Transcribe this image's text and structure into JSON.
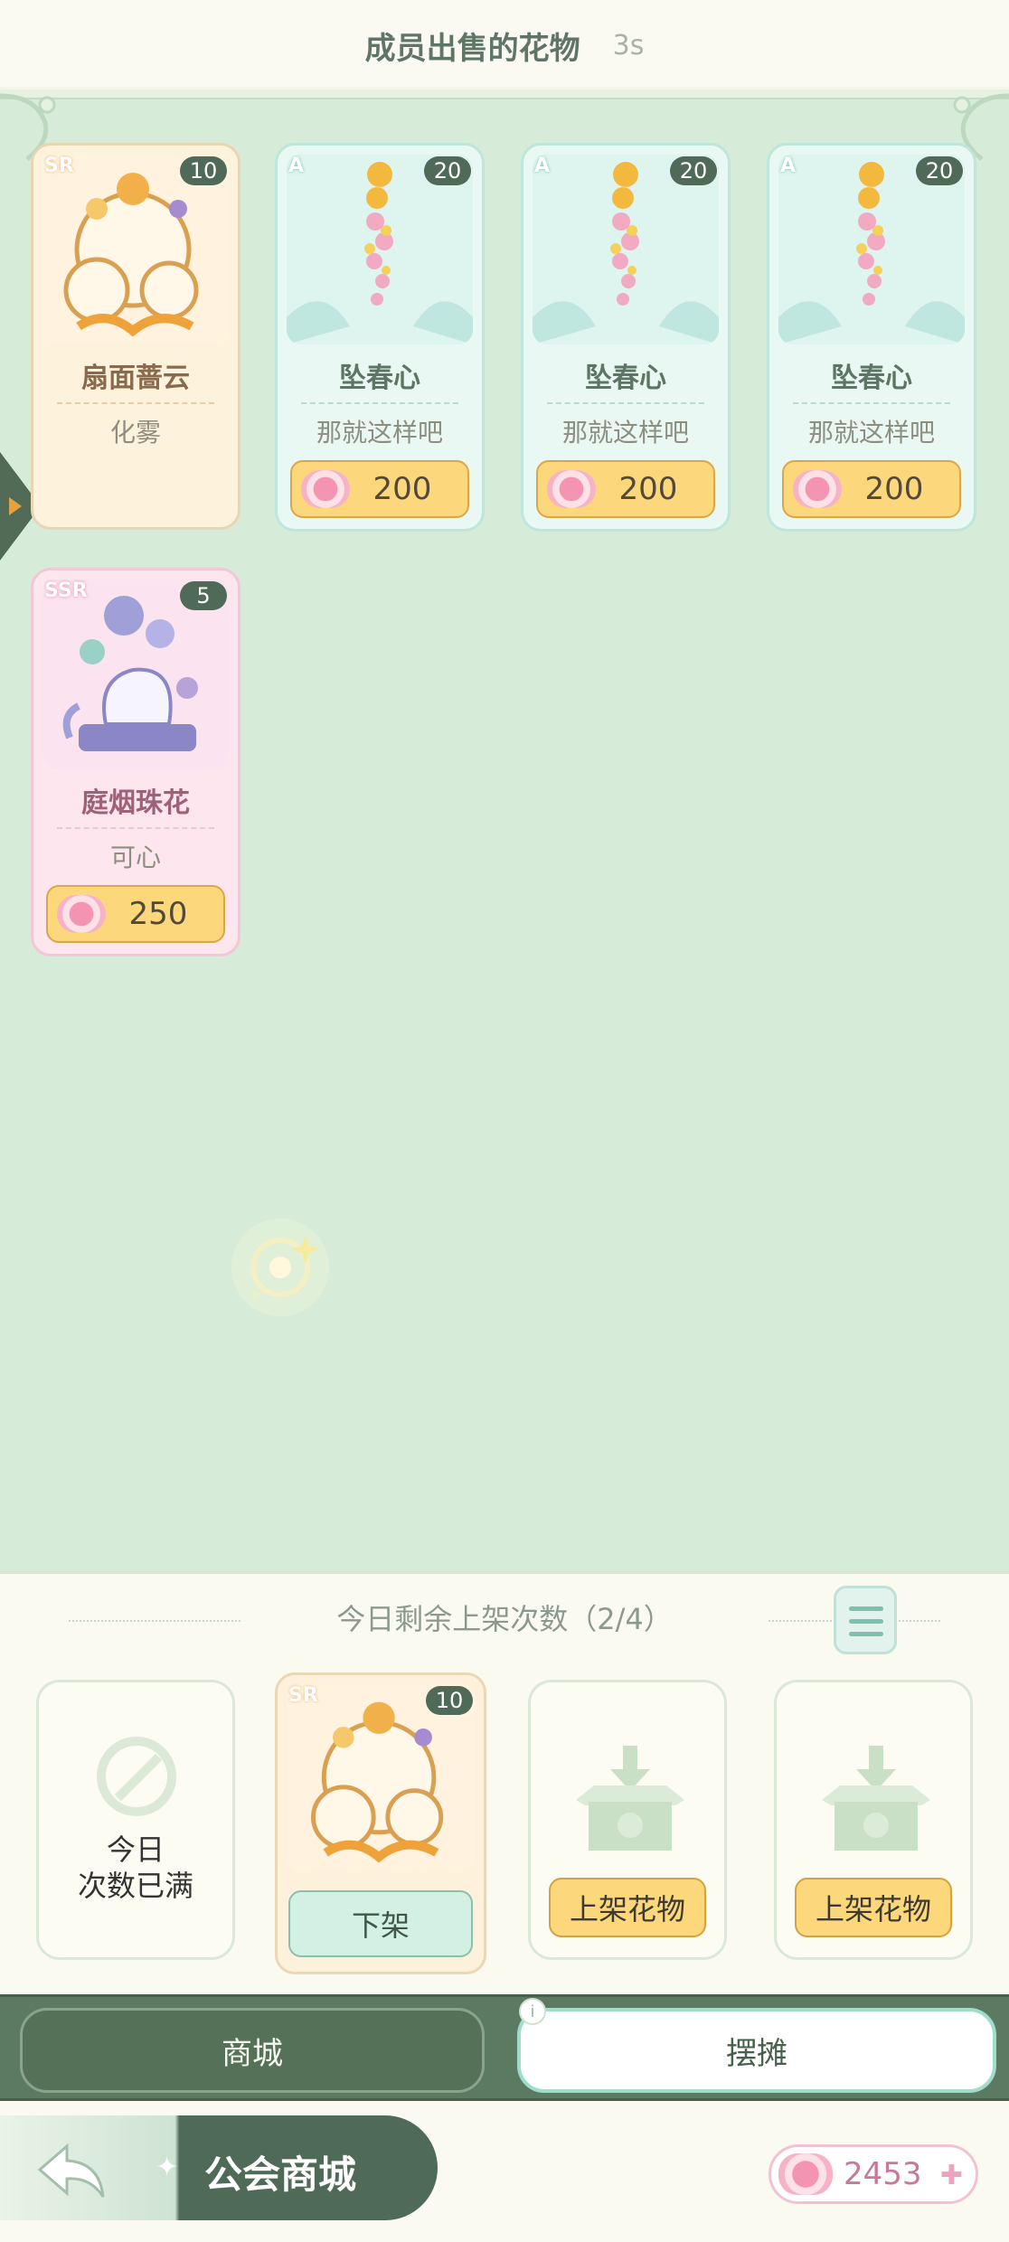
{
  "header": {
    "title": "成员出售的花物",
    "timer": "3s"
  },
  "market_cards": [
    {
      "rarity": "SR",
      "count": "10",
      "name": "扇面蔷云",
      "seller": "化雾",
      "price": ""
    },
    {
      "rarity": "A",
      "count": "20",
      "name": "坠春心",
      "seller": "那就这样吧",
      "price": "200"
    },
    {
      "rarity": "A",
      "count": "20",
      "name": "坠春心",
      "seller": "那就这样吧",
      "price": "200"
    },
    {
      "rarity": "A",
      "count": "20",
      "name": "坠春心",
      "seller": "那就这样吧",
      "price": "200"
    },
    {
      "rarity": "SSR",
      "count": "5",
      "name": "庭烟珠花",
      "seller": "可心",
      "price": "250"
    }
  ],
  "stall": {
    "quota_text": "今日剩余上架次数（2/4）",
    "sold_out_line1": "今日",
    "sold_out_line2": "次数已满",
    "listed_item": {
      "rarity": "SR",
      "count": "10",
      "delist_label": "下架"
    },
    "list_button_label": "上架花物"
  },
  "tabs": {
    "shop": "商城",
    "stall": "摆摊"
  },
  "footer": {
    "title": "公会商城",
    "currency_amount": "2453"
  },
  "colors": {
    "background": "#d6ecd8",
    "price_button": "#fcd77b",
    "dark_green": "#4f6a56",
    "pink_accent": "#c9789a"
  }
}
